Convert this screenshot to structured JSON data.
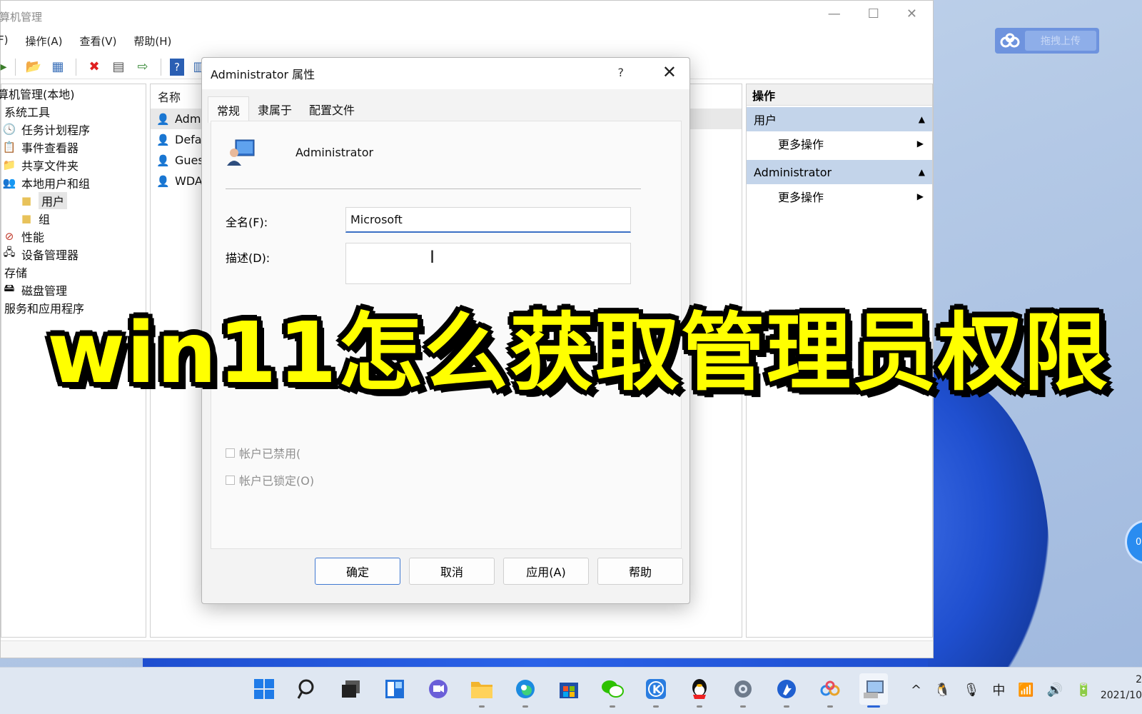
{
  "window": {
    "title": "算机管理",
    "menu": [
      "F)",
      "操作(A)",
      "查看(V)",
      "帮助(H)"
    ]
  },
  "tree": {
    "items": [
      {
        "label": "算机管理(本地)",
        "icon": "computer-icon",
        "indent": 0
      },
      {
        "label": "系统工具",
        "icon": "",
        "indent": 0
      },
      {
        "label": "任务计划程序",
        "icon": "clock-icon",
        "indent": 1
      },
      {
        "label": "事件查看器",
        "icon": "event-viewer-icon",
        "indent": 1
      },
      {
        "label": "共享文件夹",
        "icon": "shared-folder-icon",
        "indent": 1
      },
      {
        "label": "本地用户和组",
        "icon": "users-icon",
        "indent": 1
      },
      {
        "label": "用户",
        "icon": "folder-icon",
        "indent": 2,
        "selected": true
      },
      {
        "label": "组",
        "icon": "folder-icon",
        "indent": 2
      },
      {
        "label": "性能",
        "icon": "performance-icon",
        "indent": 1
      },
      {
        "label": "设备管理器",
        "icon": "device-manager-icon",
        "indent": 1
      },
      {
        "label": "存储",
        "icon": "",
        "indent": 0
      },
      {
        "label": "磁盘管理",
        "icon": "disk-icon",
        "indent": 1
      },
      {
        "label": "服务和应用程序",
        "icon": "",
        "indent": 0
      }
    ]
  },
  "list": {
    "header": "名称",
    "rows": [
      "Admi",
      "Defau",
      "Gues",
      "WDA"
    ]
  },
  "actions": {
    "header": "操作",
    "sections": [
      {
        "title": "用户",
        "item": "更多操作"
      },
      {
        "title": "Administrator",
        "item": "更多操作"
      }
    ]
  },
  "dialog": {
    "title": "Administrator 属性",
    "help": "?",
    "tabs": [
      "常规",
      "隶属于",
      "配置文件"
    ],
    "user_name": "Administrator",
    "fullname_label": "全名(F):",
    "fullname_value": "Microsoft",
    "desc_label": "描述(D):",
    "checkbox_disabled": "帐户已禁用(",
    "checkbox_locked": "帐户已锁定(O)",
    "buttons": {
      "ok": "确定",
      "cancel": "取消",
      "apply": "应用(A)",
      "help": "帮助"
    }
  },
  "overlay": {
    "caption": "win11怎么获取管理员权限"
  },
  "upload": {
    "label": "拖拽上传"
  },
  "bubble": {
    "text": "0"
  },
  "tray": {
    "ime": "中"
  },
  "clock": {
    "time": "2",
    "date": "2021/10"
  }
}
